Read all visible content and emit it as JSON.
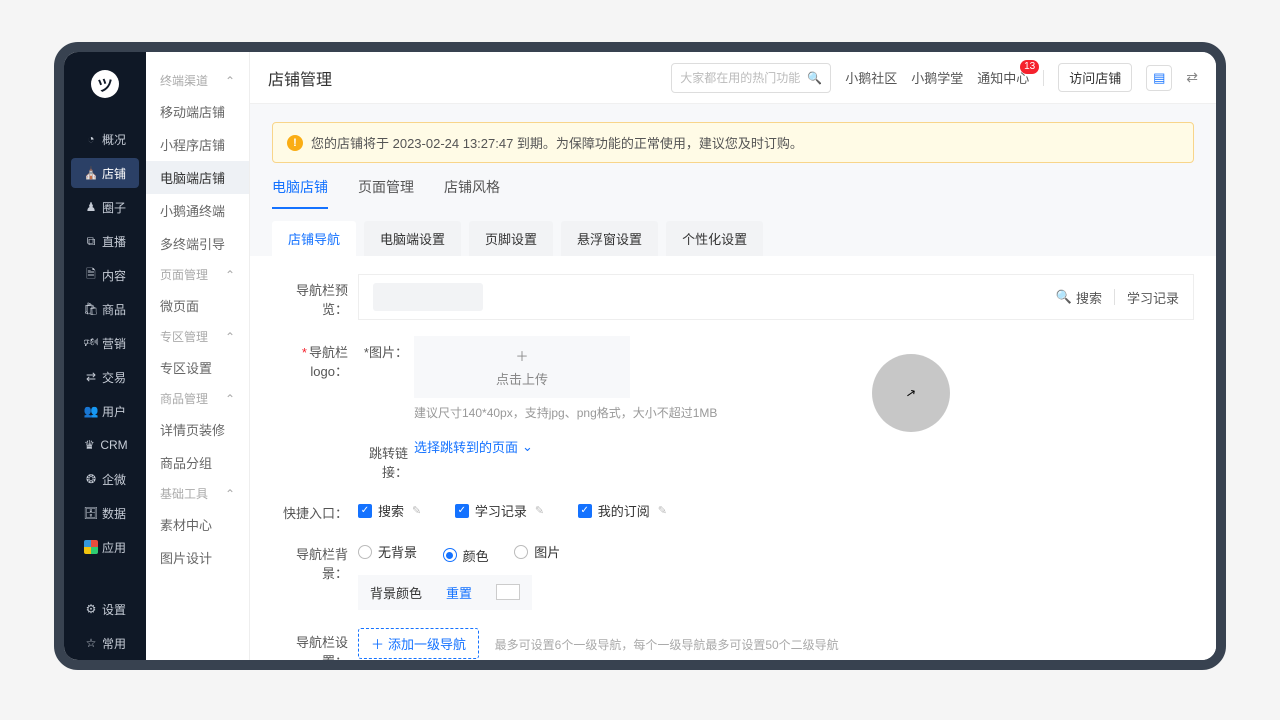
{
  "sidebar_main": {
    "items": [
      {
        "icon": "◔",
        "label": "概况"
      },
      {
        "icon": "⛪",
        "label": "店铺"
      },
      {
        "icon": "♟",
        "label": "圈子"
      },
      {
        "icon": "⧉",
        "label": "直播"
      },
      {
        "icon": "🗎",
        "label": "内容"
      },
      {
        "icon": "🛍",
        "label": "商品"
      },
      {
        "icon": "🕬",
        "label": "营销"
      },
      {
        "icon": "⇄",
        "label": "交易"
      },
      {
        "icon": "👥",
        "label": "用户"
      },
      {
        "icon": "♛",
        "label": "CRM"
      },
      {
        "icon": "❂",
        "label": "企微"
      },
      {
        "icon": "🗄",
        "label": "数据"
      },
      {
        "icon": "",
        "label": "应用"
      }
    ],
    "bottom": [
      {
        "icon": "⚙",
        "label": "设置"
      },
      {
        "icon": "☆",
        "label": "常用"
      }
    ],
    "active_index": 1
  },
  "sidebar_sub": {
    "groups": [
      {
        "title": "终端渠道",
        "items": [
          "移动端店铺",
          "小程序店铺",
          "电脑端店铺",
          "小鹅通终端",
          "多终端引导"
        ],
        "active_index": 2
      },
      {
        "title": "页面管理",
        "items": [
          "微页面"
        ]
      },
      {
        "title": "专区管理",
        "items": [
          "专区设置"
        ]
      },
      {
        "title": "商品管理",
        "items": [
          "详情页装修",
          "商品分组"
        ]
      },
      {
        "title": "基础工具",
        "items": [
          "素材中心",
          "图片设计"
        ]
      }
    ]
  },
  "topbar": {
    "title": "店铺管理",
    "search_placeholder": "大家都在用的热门功能",
    "links": [
      "小鹅社区",
      "小鹅学堂",
      "通知中心"
    ],
    "notice_count": "13",
    "visit_label": "访问店铺"
  },
  "alert": {
    "text": "您的店铺将于 2023-02-24 13:27:47 到期。为保障功能的正常使用，建议您及时订购。"
  },
  "tabs_upper": {
    "items": [
      "电脑店铺",
      "页面管理",
      "店铺风格"
    ],
    "active": 0
  },
  "tabs_lower": {
    "items": [
      "店铺导航",
      "电脑端设置",
      "页脚设置",
      "悬浮窗设置",
      "个性化设置"
    ],
    "active": 0
  },
  "form": {
    "preview_label": "导航栏预览：",
    "preview_actions": {
      "search": "搜索",
      "study": "学习记录"
    },
    "logo_label": "导航栏logo：",
    "image_label": "图片：",
    "upload_text": "点击上传",
    "upload_hint": "建议尺寸140*40px，支持jpg、png格式，大小不超过1MB",
    "jump_label": "跳转链接：",
    "jump_value": "选择跳转到的页面",
    "quick_label": "快捷入口：",
    "quick_items": [
      "搜索",
      "学习记录",
      "我的订阅"
    ],
    "bg_label": "导航栏背景：",
    "bg_options": [
      "无背景",
      "颜色",
      "图片"
    ],
    "bg_selected": 1,
    "bg_color_label": "背景颜色",
    "reset_label": "重置",
    "nav_set_label": "导航栏设置：",
    "add_nav": "添加一级导航",
    "nav_tip": "最多可设置6个一级导航，每个一级导航最多可设置50个二级导航"
  }
}
